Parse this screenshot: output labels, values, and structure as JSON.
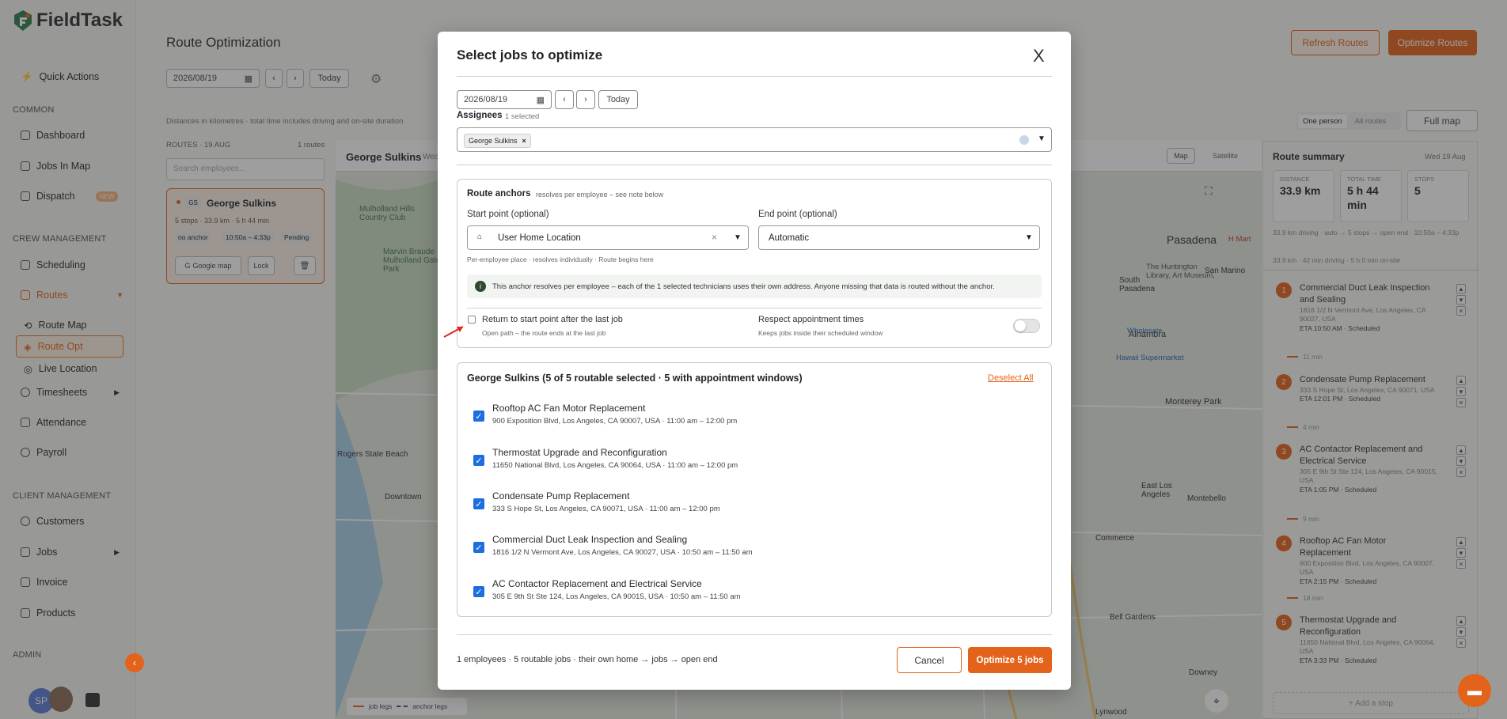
{
  "app": {
    "name": "FieldTask"
  },
  "sidebar": {
    "quick_actions": "Quick Actions",
    "sections": {
      "common": "COMMON",
      "crew": "CREW MANAGEMENT",
      "client": "CLIENT MANAGEMENT",
      "admin": "ADMIN"
    },
    "common_items": [
      "Dashboard",
      "Jobs In Map",
      "Dispatch"
    ],
    "new_badge": "NEW",
    "crew_items": [
      "Scheduling",
      "Routes"
    ],
    "route_sub": [
      "Route Map",
      "Route Opt",
      "Live Location"
    ],
    "crew_items2": [
      "Timesheets",
      "Attendance",
      "Payroll"
    ],
    "client_items": [
      "Customers",
      "Jobs",
      "Invoice",
      "Products"
    ],
    "avatar_initials": "SP"
  },
  "main": {
    "title": "Route Optimization",
    "refresh_label": "Refresh Routes",
    "optimize_label": "Optimize Routes",
    "date_value": "2026/08/19",
    "today_label": "Today",
    "distance_note": "Distances in kilometres · total time includes driving and on-site duration",
    "routes_header": "ROUTES · 19 AUG",
    "routes_count": "1 routes",
    "search_placeholder": "Search employees...",
    "route_card": {
      "initials": "GS",
      "name": "George Sulkins",
      "meta": "5 stops · 33.9 km · 5 h 44 min",
      "tag1": "no anchor",
      "tag2": "10:50a – 4:33p",
      "tag3": "Pending",
      "gmap": "Google map",
      "lock": "Lock"
    },
    "map_header": "George Sulkins",
    "map_header_sub": "Wed",
    "map_btn": "Map",
    "satellite_btn": "Satellite",
    "legend_job": "job legs",
    "legend_anchor": "anchor legs",
    "map_labels": [
      "Pasadena",
      "Mulholland Hills Country Club",
      "Marvin Braude Mulholland Gateway Park",
      "The Huntington Library, Art Museum,",
      "South Pasadena",
      "San Marino",
      "Alhambra",
      "Hawaii Supermarket",
      "Monterey Park",
      "East Los Angeles",
      "Montebello",
      "Commerce",
      "Bell Gardens",
      "Downey",
      "Lynwood",
      "Rogers State Beach",
      "Downtown",
      "Wholesale",
      "H Mart"
    ],
    "person_toggle": [
      "One person",
      "All routes"
    ],
    "full_map": "Full map"
  },
  "summary": {
    "title": "Route summary",
    "date": "Wed 19 Aug",
    "distance_label": "DISTANCE",
    "distance_value": "33.9 km",
    "time_label": "TOTAL TIME",
    "time_value": "5 h 44 min",
    "stops_label": "STOPS",
    "stops_value": "5",
    "note1": "33.9 km driving · auto → 5 stops → open end · 10:50a – 4:33p",
    "note2": "33.9 km · 42 min driving · 5 h 0 min on-site",
    "stops": [
      {
        "n": "1",
        "title": "Commercial Duct Leak Inspection and Sealing",
        "addr": "1816 1/2 N Vermont Ave, Los Angeles, CA 90027, USA",
        "eta": "ETA 10:50 AM",
        "status": "Scheduled",
        "gap": "11 min"
      },
      {
        "n": "2",
        "title": "Condensate Pump Replacement",
        "addr": "333 S Hope St, Los Angeles, CA 90071, USA",
        "eta": "ETA 12:01 PM",
        "status": "Scheduled",
        "gap": "4 min"
      },
      {
        "n": "3",
        "title": "AC Contactor Replacement and Electrical Service",
        "addr": "305 E 9th St Ste 124, Los Angeles, CA 90015, USA",
        "eta": "ETA 1:05 PM",
        "status": "Scheduled",
        "gap": "9 min"
      },
      {
        "n": "4",
        "title": "Rooftop AC Fan Motor Replacement",
        "addr": "900 Exposition Blvd, Los Angeles, CA 90007, USA",
        "eta": "ETA 2:15 PM",
        "status": "Scheduled",
        "gap": "18 min"
      },
      {
        "n": "5",
        "title": "Thermostat Upgrade and Reconfiguration",
        "addr": "11650 National Blvd, Los Angeles, CA 90064, USA",
        "eta": "ETA 3:33 PM",
        "status": "Scheduled",
        "gap": ""
      }
    ],
    "add_stop": "+ Add a stop"
  },
  "modal": {
    "title": "Select jobs to optimize",
    "close": "X",
    "date_value": "2026/08/19",
    "today_label": "Today",
    "assignees_label": "Assignees",
    "assignees_count": "1 selected",
    "assignee_chip": "George Sulkins",
    "anchors_title": "Route anchors",
    "anchors_sub": "resolves per employee – see note below",
    "start_label": "Start point (optional)",
    "start_value": "User Home Location",
    "start_help": "Per-employee place · resolves individually · Route begins here",
    "end_label": "End point (optional)",
    "end_value": "Automatic",
    "info_text": "This anchor resolves per employee – each of the 1 selected technicians uses their own address. Anyone missing that data is routed without the anchor.",
    "return_label": "Return to start point after the last job",
    "return_help": "Open path – the route ends at the last job",
    "respect_label": "Respect appointment times",
    "respect_help": "Keeps jobs inside their scheduled window",
    "group_title": "George Sulkins (5 of 5 routable selected · 5 with appointment windows)",
    "deselect_all": "Deselect All",
    "jobs": [
      {
        "title": "Rooftop AC Fan Motor Replacement",
        "sub": "900 Exposition Blvd, Los Angeles, CA 90007, USA · 11:00 am – 12:00 pm"
      },
      {
        "title": "Thermostat Upgrade and Reconfiguration",
        "sub": "11650 National Blvd, Los Angeles, CA 90064, USA · 11:00 am – 12:00 pm"
      },
      {
        "title": "Condensate Pump Replacement",
        "sub": "333 S Hope St, Los Angeles, CA 90071, USA · 11:00 am – 12:00 pm"
      },
      {
        "title": "Commercial Duct Leak Inspection and Sealing",
        "sub": "1816 1/2 N Vermont Ave, Los Angeles, CA 90027, USA · 10:50 am – 11:50 am"
      },
      {
        "title": "AC Contactor Replacement and Electrical Service",
        "sub": "305 E 9th St Ste 124, Los Angeles, CA 90015, USA · 10:50 am – 11:50 am"
      }
    ],
    "footer_text": "1 employees · 5 routable jobs · their own home → jobs → open end",
    "cancel": "Cancel",
    "optimize": "Optimize 5 jobs"
  },
  "colors": {
    "accent": "#e4631b",
    "check": "#1d6fe0"
  }
}
